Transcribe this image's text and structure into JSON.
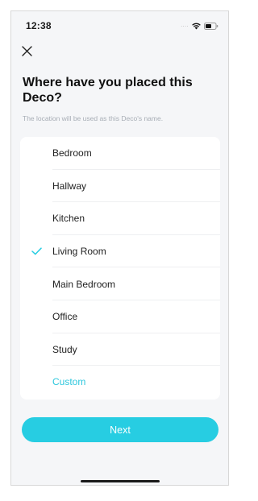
{
  "status_bar": {
    "time": "12:38",
    "signal_dots": "....",
    "icons": [
      "wifi-icon",
      "battery-icon"
    ]
  },
  "header": {
    "close_icon": "close-icon",
    "title": "Where have you placed this Deco?",
    "subtitle": "The location will be used as this Deco's name."
  },
  "locations": {
    "items": [
      {
        "label": "Bedroom",
        "selected": false
      },
      {
        "label": "Hallway",
        "selected": false
      },
      {
        "label": "Kitchen",
        "selected": false
      },
      {
        "label": "Living Room",
        "selected": true
      },
      {
        "label": "Main Bedroom",
        "selected": false
      },
      {
        "label": "Office",
        "selected": false
      },
      {
        "label": "Study",
        "selected": false
      },
      {
        "label": "Custom",
        "selected": false
      }
    ],
    "check_icon": "check-icon"
  },
  "actions": {
    "next_label": "Next"
  },
  "colors": {
    "accent": "#27cde2",
    "custom_text": "#2ec7dd",
    "background": "#f5f6f8",
    "subtitle": "#a8aeb6"
  }
}
